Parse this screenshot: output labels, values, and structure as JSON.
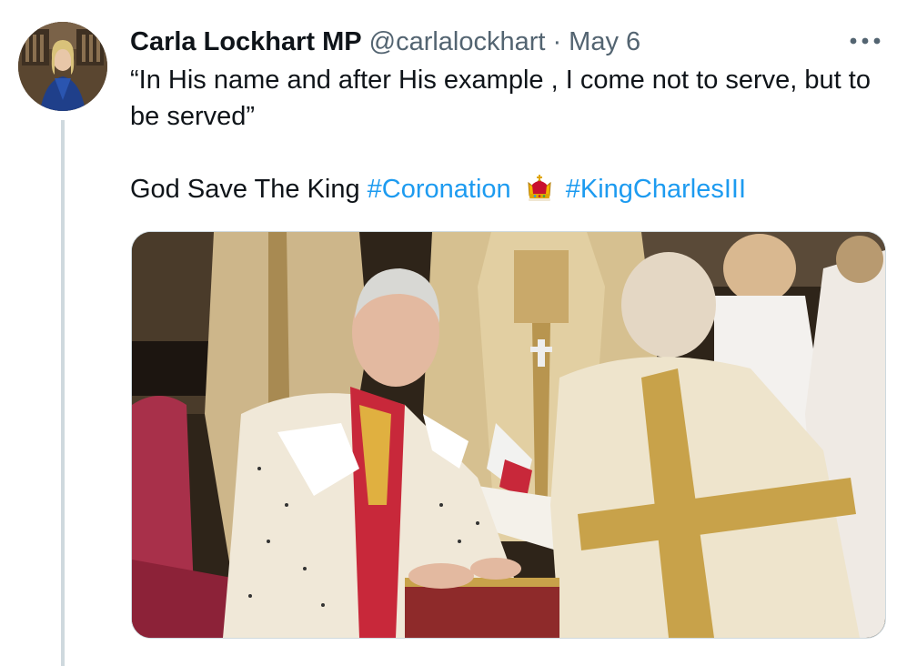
{
  "author": {
    "display_name": "Carla Lockhart MP",
    "handle": "@carlalockhart",
    "separator": "·",
    "date": "May 6"
  },
  "more_menu": {
    "label": "•••"
  },
  "tweet": {
    "quote": "“In His name and after His example , I come not to serve, but to be served”",
    "closing_text": "God Save The King",
    "hashtags": [
      "#Coronation",
      "#KingCharlesIII"
    ],
    "emoji": "crown-emoji"
  },
  "colors": {
    "text": "#0f1419",
    "secondary": "#536471",
    "link": "#1d9bf0",
    "thread_line": "#cfd9de"
  }
}
